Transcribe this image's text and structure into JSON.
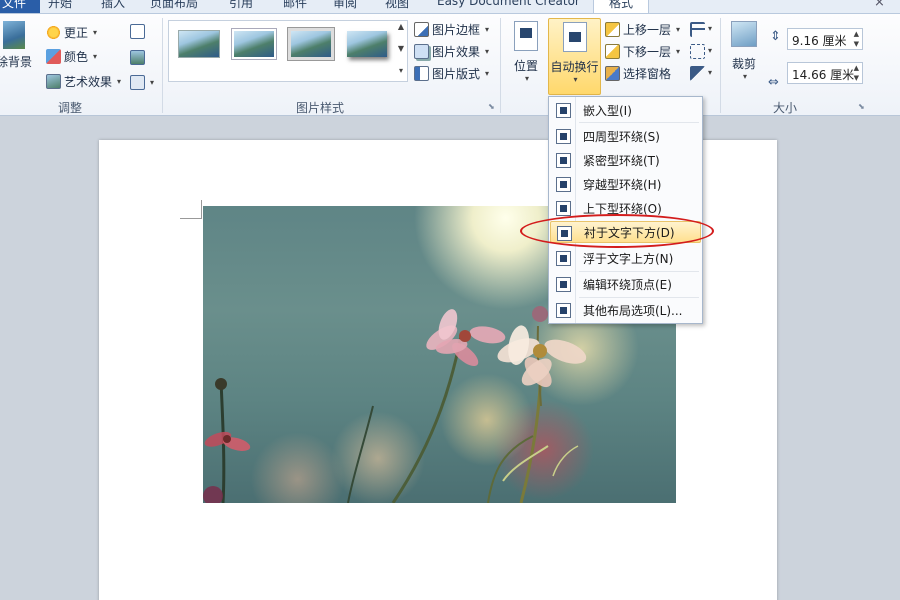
{
  "tabs": {
    "file": "文件",
    "items": [
      "开始",
      "插入",
      "页面布局",
      "引用",
      "邮件",
      "审阅",
      "视图",
      "Easy Document Creator"
    ],
    "active": "格式",
    "close": "×"
  },
  "ribbon": {
    "adjust": {
      "remove_bg": "除背景",
      "corrections": "更正",
      "color": "颜色",
      "artistic": "艺术效果",
      "label": "调整"
    },
    "picture_styles": {
      "border": "图片边框",
      "effects": "图片效果",
      "layout": "图片版式",
      "label": "图片样式"
    },
    "arrange": {
      "position": "位置",
      "wrap_text": "自动换行",
      "bring_forward": "上移一层",
      "send_backward": "下移一层",
      "selection_pane": "选择窗格"
    },
    "size": {
      "crop": "裁剪",
      "height": "9.16 厘米",
      "width": "14.66 厘米",
      "label": "大小"
    }
  },
  "wrap_menu": {
    "items": [
      {
        "label": "嵌入型(I)",
        "icon": "inline-wrap-icon"
      },
      {
        "label": "四周型环绕(S)",
        "icon": "square-wrap-icon"
      },
      {
        "label": "紧密型环绕(T)",
        "icon": "tight-wrap-icon"
      },
      {
        "label": "穿越型环绕(H)",
        "icon": "through-wrap-icon"
      },
      {
        "label": "上下型环绕(O)",
        "icon": "top-bottom-wrap-icon"
      },
      {
        "label": "衬于文字下方(D)",
        "icon": "behind-text-icon",
        "highlighted": true
      },
      {
        "label": "浮于文字上方(N)",
        "icon": "in-front-text-icon"
      },
      {
        "label": "编辑环绕顶点(E)",
        "icon": "edit-wrap-points-icon"
      },
      {
        "label": "其他布局选项(L)...",
        "icon": "more-layout-icon"
      }
    ]
  },
  "colors": {
    "accent": "#2a5ea8",
    "highlight": "#ffe08f",
    "annotation": "#d31c1c"
  }
}
